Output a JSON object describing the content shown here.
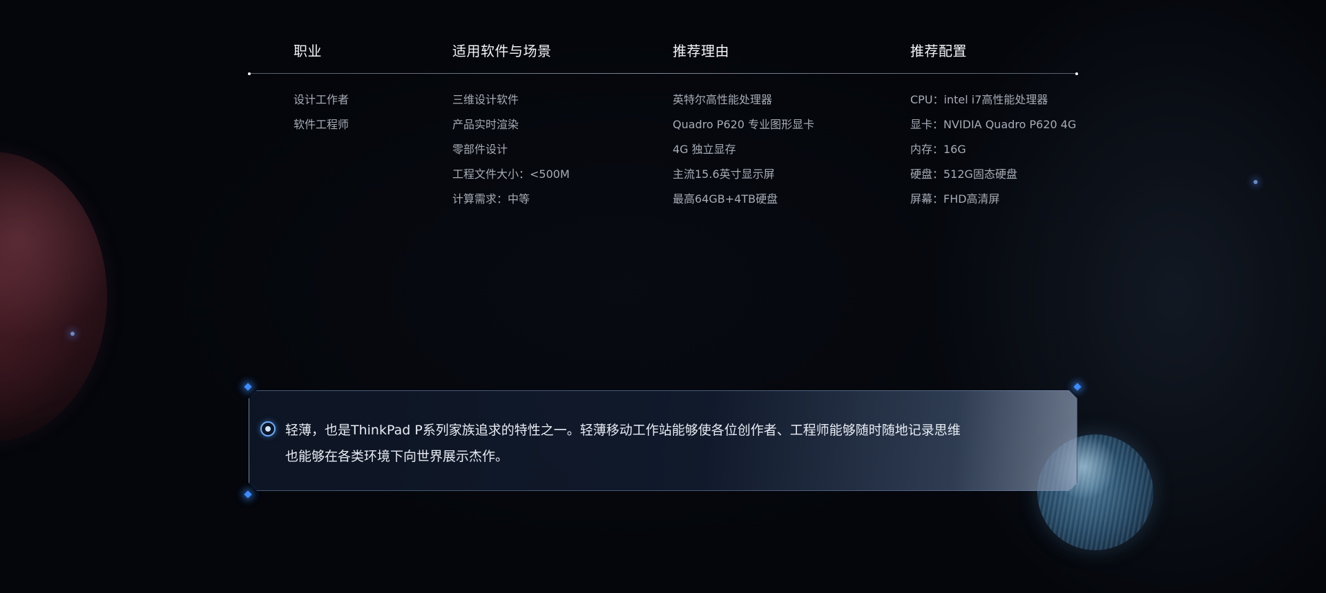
{
  "table": {
    "headers": [
      "职业",
      "适用软件与场景",
      "推荐理由",
      "推荐配置"
    ],
    "columns": [
      [
        "设计工作者",
        "软件工程师"
      ],
      [
        "三维设计软件",
        "产品实时渲染",
        "零部件设计",
        "工程文件大小：<500M",
        "计算需求：中等"
      ],
      [
        "英特尔高性能处理器",
        "Quadro P620 专业图形显卡",
        "4G 独立显存",
        "主流15.6英寸显示屏",
        "最高64GB+4TB硬盘"
      ],
      [
        "CPU：intel i7高性能处理器",
        "显卡：NVIDIA Quadro P620 4G",
        "内存：16G",
        "硬盘：512G固态硬盘",
        "屏幕：FHD高清屏"
      ]
    ]
  },
  "note": {
    "line1": "轻薄，也是ThinkPad P系列家族追求的特性之一。轻薄移动工作站能够使各位创作者、工程师能够随时随地记录思维",
    "line2": "也能够在各类环境下向世界展示杰作。"
  },
  "colors": {
    "background": "#04060b",
    "accent": "#3c8cff",
    "header_text": "#f2f4f8",
    "body_text": "#a7acb6"
  }
}
